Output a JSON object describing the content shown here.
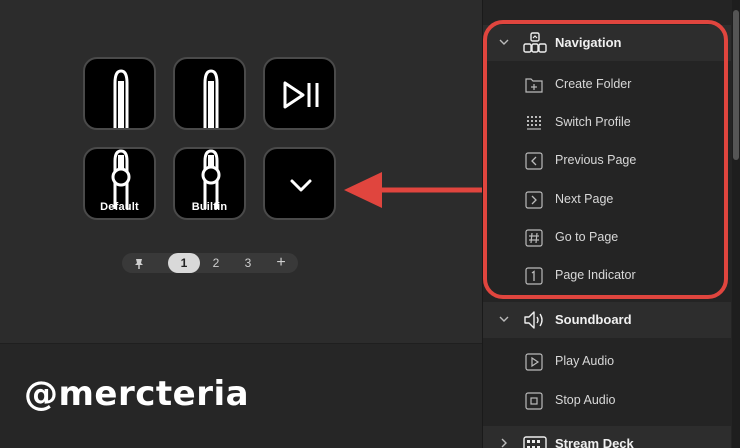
{
  "keys": [
    {
      "name": "slider-key-1",
      "label": "",
      "type": "slider-full"
    },
    {
      "name": "slider-key-2",
      "label": "",
      "type": "slider-full"
    },
    {
      "name": "play-pause-key",
      "label": "",
      "type": "play-pause"
    },
    {
      "name": "default-slider-key",
      "label": "Default",
      "type": "slider-knob"
    },
    {
      "name": "builtin-slider-key",
      "label": "Builtin",
      "type": "slider-knob"
    },
    {
      "name": "chevron-down-key",
      "label": "",
      "type": "chevron"
    }
  ],
  "pager": {
    "pin": "pin-icon",
    "pages": [
      "1",
      "2",
      "3"
    ],
    "active": "1",
    "add": "+"
  },
  "watermark": "@mercteria",
  "sidebar": {
    "navigation": {
      "label": "Navigation",
      "icon": "navigation-icon",
      "items": [
        {
          "label": "Create Folder",
          "icon": "create-folder-icon"
        },
        {
          "label": "Switch Profile",
          "icon": "switch-profile-icon"
        },
        {
          "label": "Previous Page",
          "icon": "previous-page-icon"
        },
        {
          "label": "Next Page",
          "icon": "next-page-icon"
        },
        {
          "label": "Go to Page",
          "icon": "go-to-page-icon"
        },
        {
          "label": "Page Indicator",
          "icon": "page-indicator-icon"
        }
      ]
    },
    "soundboard": {
      "label": "Soundboard",
      "icon": "speaker-icon",
      "items": [
        {
          "label": "Play Audio",
          "icon": "play-audio-icon"
        },
        {
          "label": "Stop Audio",
          "icon": "stop-audio-icon"
        }
      ]
    },
    "stream_deck": {
      "label": "Stream Deck",
      "icon": "stream-deck-icon"
    }
  },
  "colors": {
    "highlight": "#e0453e",
    "arrow": "#e0453e",
    "background": "#2c2c2c",
    "sidebar": "#242424"
  }
}
